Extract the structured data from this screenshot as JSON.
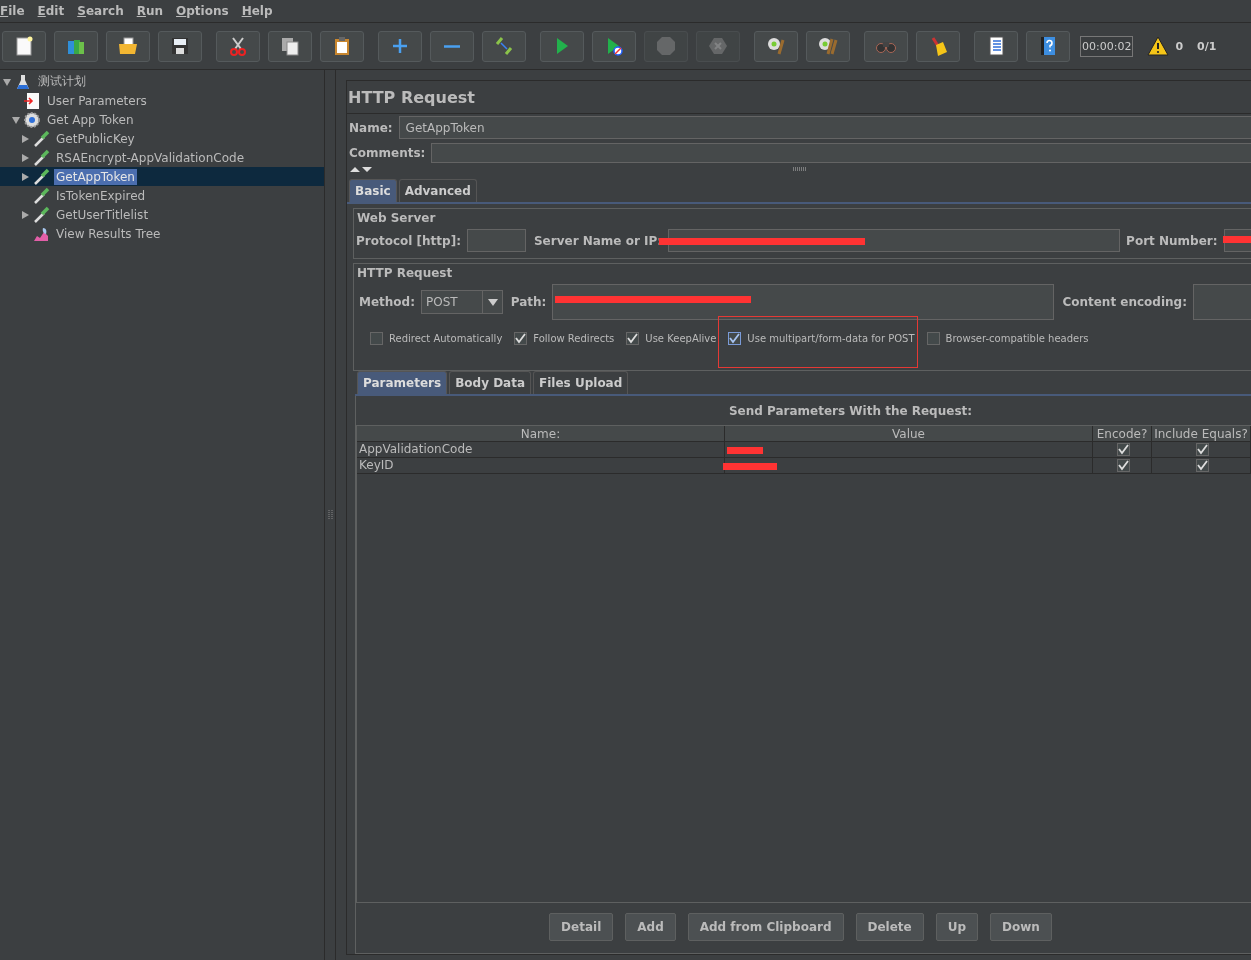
{
  "menu": [
    {
      "label": "File"
    },
    {
      "label": "Edit"
    },
    {
      "label": "Search"
    },
    {
      "label": "Run"
    },
    {
      "label": "Options"
    },
    {
      "label": "Help"
    }
  ],
  "toolbar": {
    "groups": [
      [
        {
          "kind": "new",
          "disabled": false
        },
        {
          "kind": "templates",
          "disabled": false
        },
        {
          "kind": "open",
          "disabled": false
        },
        {
          "kind": "save",
          "disabled": false
        }
      ],
      [
        {
          "kind": "cut",
          "disabled": false
        },
        {
          "kind": "copy",
          "disabled": false
        },
        {
          "kind": "paste",
          "disabled": false
        }
      ],
      [
        {
          "kind": "expand",
          "disabled": false
        },
        {
          "kind": "collapse",
          "disabled": false
        },
        {
          "kind": "toggle",
          "disabled": false
        }
      ],
      [
        {
          "kind": "start",
          "disabled": false
        },
        {
          "kind": "start-no-pause",
          "disabled": false
        },
        {
          "kind": "stop",
          "disabled": true
        },
        {
          "kind": "shutdown",
          "disabled": true
        }
      ],
      [
        {
          "kind": "clear",
          "disabled": false
        },
        {
          "kind": "clear-all",
          "disabled": false
        }
      ],
      [
        {
          "kind": "search",
          "disabled": false
        },
        {
          "kind": "reset-search",
          "disabled": false
        }
      ],
      [
        {
          "kind": "function-helper",
          "disabled": false
        },
        {
          "kind": "help",
          "disabled": false
        }
      ]
    ],
    "timer": "00:00:02",
    "warnings": "0",
    "threads": "0/1"
  },
  "tree": [
    {
      "label": "测试计划",
      "kind": "test-plan",
      "expanded": true,
      "selected": false,
      "children": [
        {
          "label": "User Parameters",
          "kind": "parameters",
          "selected": false
        },
        {
          "label": "Get App Token",
          "kind": "controller",
          "expanded": true,
          "selected": false,
          "children": [
            {
              "label": "GetPublicKey",
              "kind": "sampler",
              "expanded": false,
              "selected": false
            },
            {
              "label": "RSAEncrypt-AppValidationCode",
              "kind": "sampler",
              "expanded": false,
              "selected": false
            },
            {
              "label": "GetAppToken",
              "kind": "sampler",
              "expanded": false,
              "selected": true
            },
            {
              "label": "IsTokenExpired",
              "kind": "sampler",
              "selected": false
            },
            {
              "label": "GetUserTitlelist",
              "kind": "sampler",
              "expanded": false,
              "selected": false
            },
            {
              "label": "View Results Tree",
              "kind": "listener",
              "selected": false
            }
          ]
        }
      ]
    }
  ],
  "panel": {
    "title": "HTTP Request",
    "name_label": "Name:",
    "name_value": "GetAppToken",
    "comments_label": "Comments:",
    "tabs": [
      {
        "label": "Basic",
        "selected": true
      },
      {
        "label": "Advanced",
        "selected": false
      }
    ],
    "web_server": {
      "legend": "Web Server",
      "protocol_label": "Protocol [http]:",
      "server_label": "Server Name or IP:",
      "server_redacted": true,
      "port_label": "Port Number:",
      "port_redacted": true
    },
    "http_request": {
      "legend": "HTTP Request",
      "method_label": "Method:",
      "method": "POST",
      "path_label": "Path:",
      "path_redacted": true,
      "encoding_label": "Content encoding:"
    },
    "options": [
      {
        "label": "Redirect Automatically",
        "checked": false,
        "highlighted": false
      },
      {
        "label": "Follow Redirects",
        "checked": true,
        "highlighted": false
      },
      {
        "label": "Use KeepAlive",
        "checked": true,
        "highlighted": false
      },
      {
        "label": "Use multipart/form-data for POST",
        "checked": true,
        "highlighted": true
      },
      {
        "label": "Browser-compatible headers",
        "checked": false,
        "highlighted": false
      }
    ],
    "sub_tabs": [
      {
        "label": "Parameters",
        "selected": true
      },
      {
        "label": "Body Data",
        "selected": false
      },
      {
        "label": "Files Upload",
        "selected": false
      }
    ],
    "table": {
      "title": "Send Parameters With the Request:",
      "columns": [
        "Name:",
        "Value",
        "Encode?",
        "Include Equals?"
      ],
      "rows": [
        {
          "name": "AppValidationCode",
          "value_redacted": true,
          "encode": true,
          "include_equals": true
        },
        {
          "name": "KeyID",
          "value_redacted": true,
          "encode": true,
          "include_equals": true
        }
      ]
    },
    "buttons": [
      "Detail",
      "Add",
      "Add from Clipboard",
      "Delete",
      "Up",
      "Down"
    ]
  }
}
